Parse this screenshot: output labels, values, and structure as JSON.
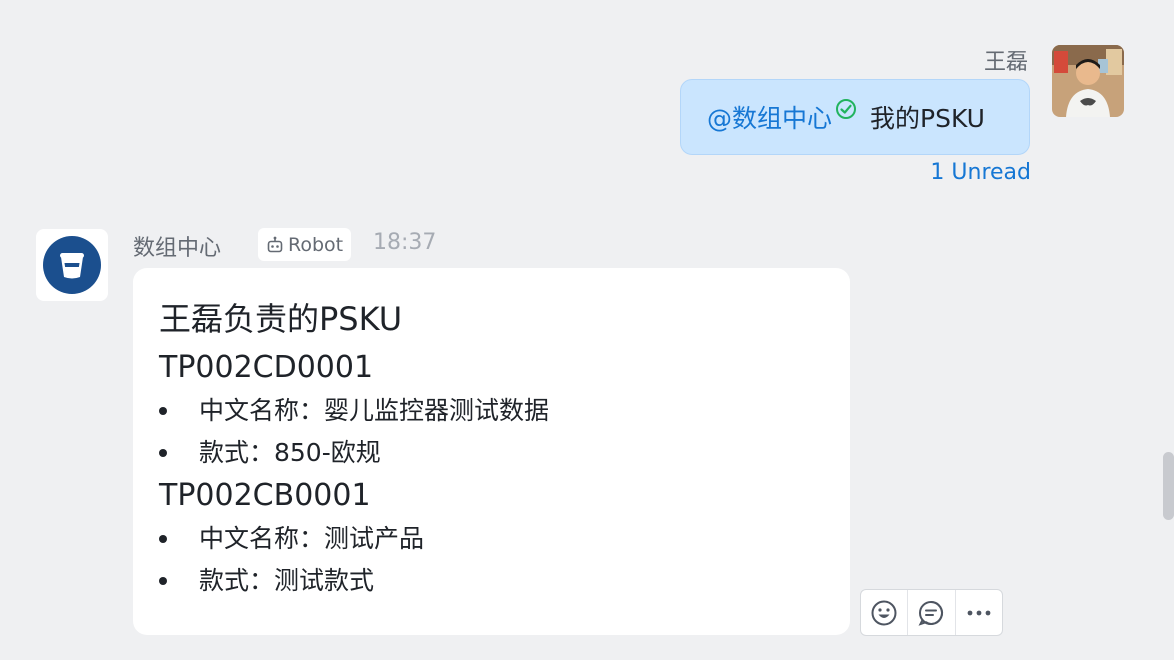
{
  "outgoing": {
    "sender": "王磊",
    "mention": "@数组中心",
    "text": "我的PSKU",
    "unread": "1 Unread"
  },
  "incoming": {
    "sender": "数组中心",
    "badge": "Robot",
    "time": "18:37",
    "card": {
      "title": "王磊负责的PSKU",
      "items": [
        {
          "sku": "TP002CD0001",
          "lines": [
            "中文名称：婴儿监控器测试数据",
            "款式：850-欧规"
          ]
        },
        {
          "sku": "TP002CB0001",
          "lines": [
            "中文名称：测试产品",
            "款式：测试款式"
          ]
        }
      ]
    }
  },
  "toolbar": {
    "icons": [
      "emoji-icon",
      "reply-icon",
      "more-icon"
    ]
  },
  "colors": {
    "bubble": "#cae5fe",
    "mention": "#1677d4",
    "check": "#22b35e",
    "bot_avatar": "#1b4f8e",
    "background": "#eff0f2"
  }
}
